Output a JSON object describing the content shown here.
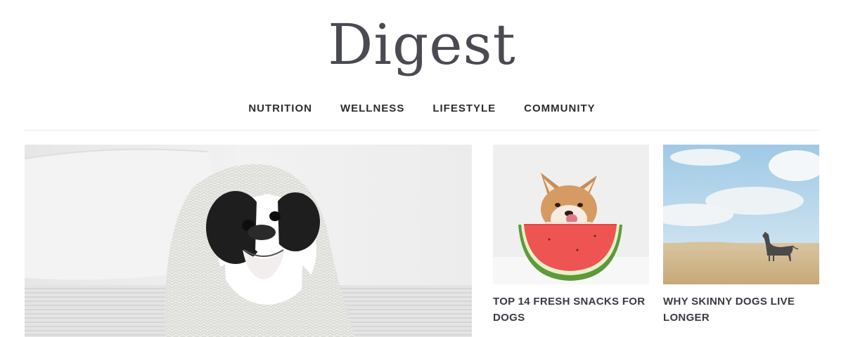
{
  "site": {
    "logo": "Digest"
  },
  "nav": [
    {
      "label": "NUTRITION"
    },
    {
      "label": "WELLNESS"
    },
    {
      "label": "LIFESTYLE"
    },
    {
      "label": "COMMUNITY"
    }
  ],
  "hero": {
    "image_alt": "French bulldog wrapped in a white knit blanket"
  },
  "cards": [
    {
      "title": "TOP 14 FRESH SNACKS FOR DOGS",
      "image_alt": "Shiba inu licking its nose behind a watermelon slice"
    },
    {
      "title": "WHY SKINNY DOGS LIVE LONGER",
      "image_alt": "Lean dog standing in a dry grass field under a cloudy sky"
    }
  ],
  "colors": {
    "logo": "#4a4b52",
    "nav_text": "#2c2c2c",
    "card_title": "#3a3b42",
    "divider": "#ececec"
  }
}
